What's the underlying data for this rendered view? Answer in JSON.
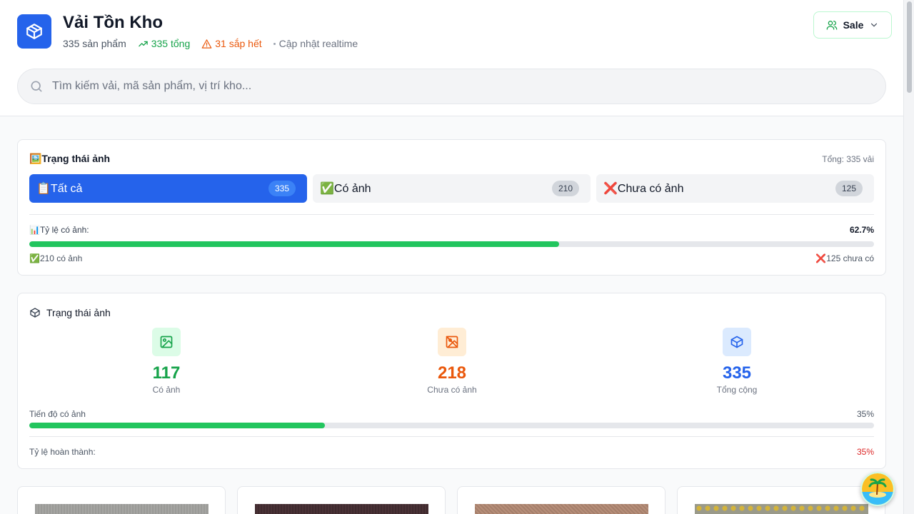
{
  "header": {
    "title": "Vải Tồn Kho",
    "product_count": "335 sản phẩm",
    "total": "335 tổng",
    "low_stock": "31 sắp hết",
    "update": "Cập nhật realtime",
    "role": "Sale",
    "brand_color": "#2563eb"
  },
  "search": {
    "placeholder": "Tìm kiếm vải, mã sản phẩm, vị trí kho..."
  },
  "image_status": {
    "title": "🖼️Trạng thái ảnh",
    "total": "Tổng: 335 vải",
    "filters": [
      {
        "label": "📋Tất cả",
        "count": "335",
        "active": true
      },
      {
        "label": "✅Có ảnh",
        "count": "210",
        "active": false
      },
      {
        "label": "❌Chưa có ảnh",
        "count": "125",
        "active": false
      }
    ],
    "ratio_label": "📊Tỷ lệ có ảnh:",
    "ratio_value": "62.7%",
    "ratio_fraction": 0.627,
    "has_text": "✅210 có ảnh",
    "missing_text": "❌125 chưa có"
  },
  "stats": {
    "title": "Trạng thái ảnh",
    "items": [
      {
        "value": "117",
        "label": "Có ảnh",
        "icon": "image-icon",
        "color": "#16a34a",
        "bg": "#dcfce7"
      },
      {
        "value": "218",
        "label": "Chưa có ảnh",
        "icon": "image-off-icon",
        "color": "#ea580c",
        "bg": "#ffedd5"
      },
      {
        "value": "335",
        "label": "Tổng cộng",
        "icon": "package-icon",
        "color": "#2563eb",
        "bg": "#dbeafe"
      }
    ],
    "progress_label": "Tiến độ có ảnh",
    "progress_value": "35%",
    "progress_fraction": 0.35,
    "completion_label": "Tỷ lệ hoàn thành:",
    "completion_value": "35%"
  }
}
